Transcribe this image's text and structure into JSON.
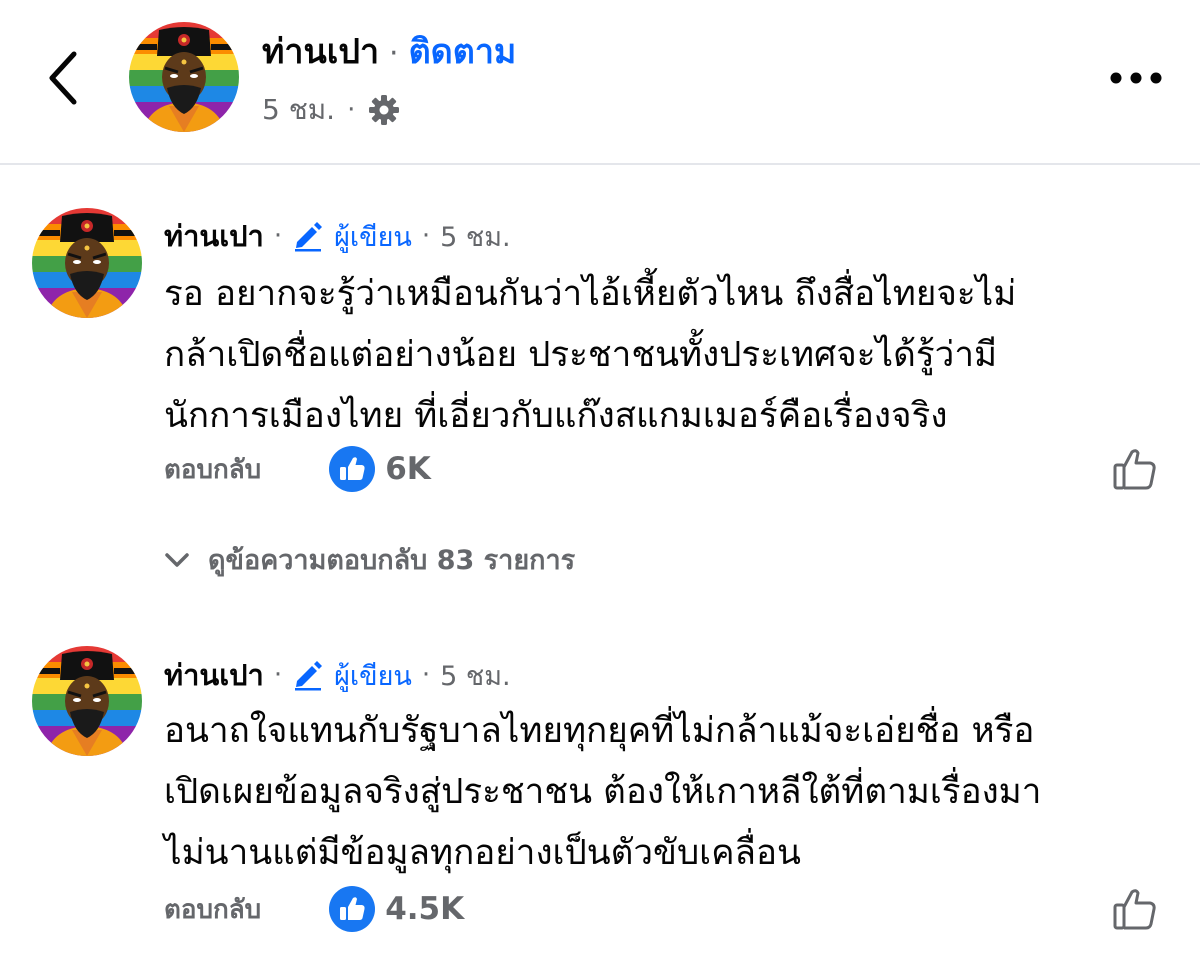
{
  "header": {
    "name": "ท่านเปา",
    "dot": "·",
    "follow_label": "ติดตาม",
    "time": "5 ชม.",
    "meta_dot": "·",
    "privacy_icon": "gear-icon"
  },
  "comments": [
    {
      "name": "ท่านเปา",
      "sep1": "·",
      "badge": "ผู้เขียน",
      "sep2": "·",
      "time": "5 ชม.",
      "lines": [
        "รอ อยากจะรู้ว่าเหมือนกันว่าไอ้เหี้ยตัวไหน ถึงสื่อไทยจะไม่",
        "กล้าเปิดชื่อแต่อย่างน้อย ประชาชนทั้งประเทศจะได้รู้ว่ามี",
        "นักการเมืองไทย ที่เอี่ยวกับแก๊งสแกมเมอร์คือเรื่องจริง"
      ],
      "reply_label": "ตอบกลับ",
      "likes": "6K",
      "view_replies": "ดูข้อความตอบกลับ 83 รายการ"
    },
    {
      "name": "ท่านเปา",
      "sep1": "·",
      "badge": "ผู้เขียน",
      "sep2": "·",
      "time": "5 ชม.",
      "lines": [
        "อนาถใจแทนกับรัฐบาลไทยทุกยุคที่ไม่กล้าแม้จะเอ่ยชื่อ หรือ",
        "เปิดเผยข้อมูลจริงสู่ประชาชน ต้องให้เกาหลีใต้ที่ตามเรื่องมา",
        "ไม่นานแต่มีข้อมูลทุกอย่างเป็นตัวขับเคลื่อน"
      ],
      "reply_label": "ตอบกลับ",
      "likes": "4.5K"
    }
  ],
  "colors": {
    "accent": "#0866ff",
    "secondary_text": "#65676b",
    "primary_text": "#050505",
    "divider": "#e4e6eb"
  }
}
